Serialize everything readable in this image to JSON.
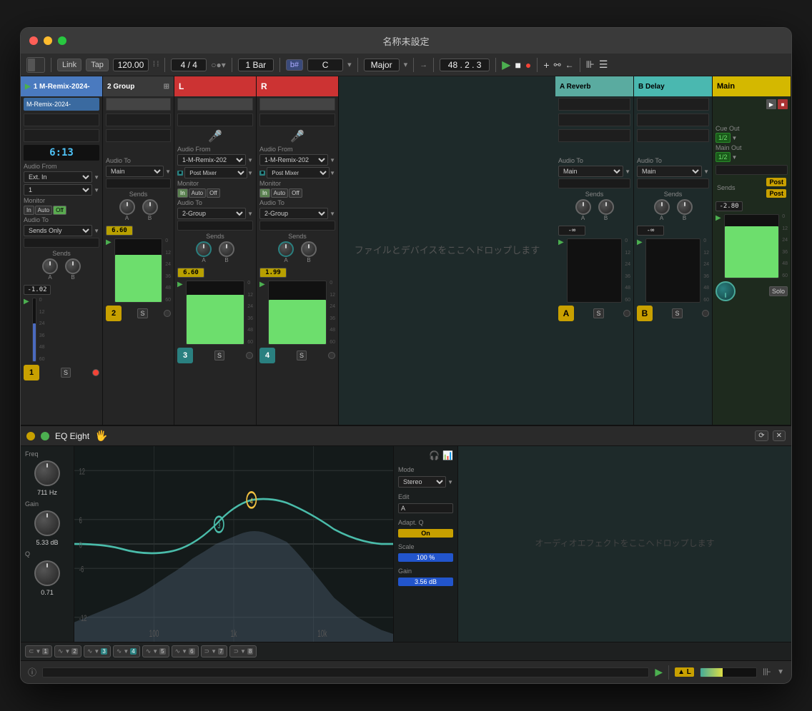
{
  "window": {
    "title": "名称未設定"
  },
  "toolbar": {
    "link": "Link",
    "tap": "Tap",
    "bpm": "120.00",
    "time_sig": "4 / 4",
    "bar": "1 Bar",
    "key_flat": "b#",
    "key": "C",
    "scale": "Major",
    "position": "48 . 2 . 3",
    "play": "▶",
    "stop": "■",
    "record": "●",
    "add": "+",
    "loop": "⟲"
  },
  "channels": [
    {
      "id": "ch1",
      "name": "1 M-Remix-2024-",
      "color": "ch1",
      "clip": "M-Remix-2024-",
      "time": "6:13",
      "audio_from_label": "Audio From",
      "audio_from": "Ext. In",
      "monitor_label": "Monitor",
      "monitor_in": "In",
      "monitor_auto": "Auto",
      "monitor_off": "Off",
      "audio_to_label": "Audio To",
      "audio_to": "Sends Only",
      "sends_label": "Sends",
      "sends_a": "A",
      "sends_b": "B",
      "fader_value": "-1.02",
      "number": "1",
      "solo": "S",
      "arm": true
    },
    {
      "id": "ch2",
      "name": "2 Group",
      "color": "ch2",
      "clip": null,
      "audio_to_label": "Audio To",
      "audio_to": "Main",
      "sends_label": "Sends",
      "sends_a": "A",
      "sends_b": "B",
      "fader_value": "6.60",
      "number": "2",
      "solo": "S",
      "arm": false
    },
    {
      "id": "chL",
      "name": "L",
      "color": "chL",
      "audio_from_label": "Audio From",
      "audio_from": "1-M-Remix-202",
      "post_mixer": "Post Mixer",
      "monitor_label": "Monitor",
      "monitor_in": "In",
      "monitor_auto": "Auto",
      "monitor_off": "Off",
      "audio_to_label": "Audio To",
      "audio_to": "2-Group",
      "sends_label": "Sends",
      "fader_value": "6.60",
      "number": "3",
      "solo": "S",
      "arm": false
    },
    {
      "id": "chR",
      "name": "R",
      "color": "chR",
      "audio_from_label": "Audio From",
      "audio_from": "1-M-Remix-202",
      "post_mixer": "Post Mixer",
      "monitor_label": "Monitor",
      "monitor_in": "In",
      "monitor_auto": "Auto",
      "monitor_off": "Off",
      "audio_to_label": "Audio To",
      "audio_to": "2-Group",
      "sends_label": "Sends",
      "fader_value": "1.99",
      "number": "4",
      "solo": "S",
      "arm": false
    }
  ],
  "drop_zone": {
    "text": "ファイルとデバイスをここへドロップします"
  },
  "returns": [
    {
      "id": "reverb",
      "name": "A Reverb",
      "color": "reverb",
      "audio_to_label": "Audio To",
      "audio_to": "Main",
      "sends_label": "Sends",
      "sends_a": "A",
      "sends_b": "B",
      "fader_value": "-∞",
      "letter": "A",
      "solo": "S"
    },
    {
      "id": "delay",
      "name": "B Delay",
      "color": "delay",
      "audio_to_label": "Audio To",
      "audio_to": "Main",
      "sends_label": "Sends",
      "sends_a": "A",
      "sends_b": "B",
      "fader_value": "-∞",
      "letter": "B",
      "solo": "S"
    }
  ],
  "main": {
    "name": "Main",
    "color": "main",
    "cue_out_label": "Cue Out",
    "cue_out_value": "1/2",
    "main_out_label": "Main Out",
    "main_out_value": "1/2",
    "sends_label": "Sends",
    "post1": "Post",
    "post2": "Post",
    "fader_value": "-2.80",
    "solo": "Solo"
  },
  "eq_plugin": {
    "name": "EQ Eight",
    "freq_label": "Freq",
    "freq_value": "711 Hz",
    "gain_label": "Gain",
    "gain_value": "5.33 dB",
    "q_label": "Q",
    "q_value": "0.71",
    "mode_label": "Mode",
    "mode_value": "Stereo",
    "edit_label": "Edit",
    "edit_value": "A",
    "adapt_q_label": "Adapt. Q",
    "adapt_q_value": "On",
    "scale_label": "Scale",
    "scale_value": "100 %",
    "gain_out_label": "Gain",
    "gain_out_value": "3.56 dB",
    "bands": [
      "1",
      "2",
      "3",
      "4",
      "5",
      "6",
      "7",
      "8"
    ],
    "grid_lines": [
      "-12",
      "-6",
      "0",
      "6",
      "12"
    ],
    "freq_labels": [
      "100",
      "1k",
      "10k"
    ],
    "drop_text": "オーディオエフェクトをここへドロップします"
  }
}
